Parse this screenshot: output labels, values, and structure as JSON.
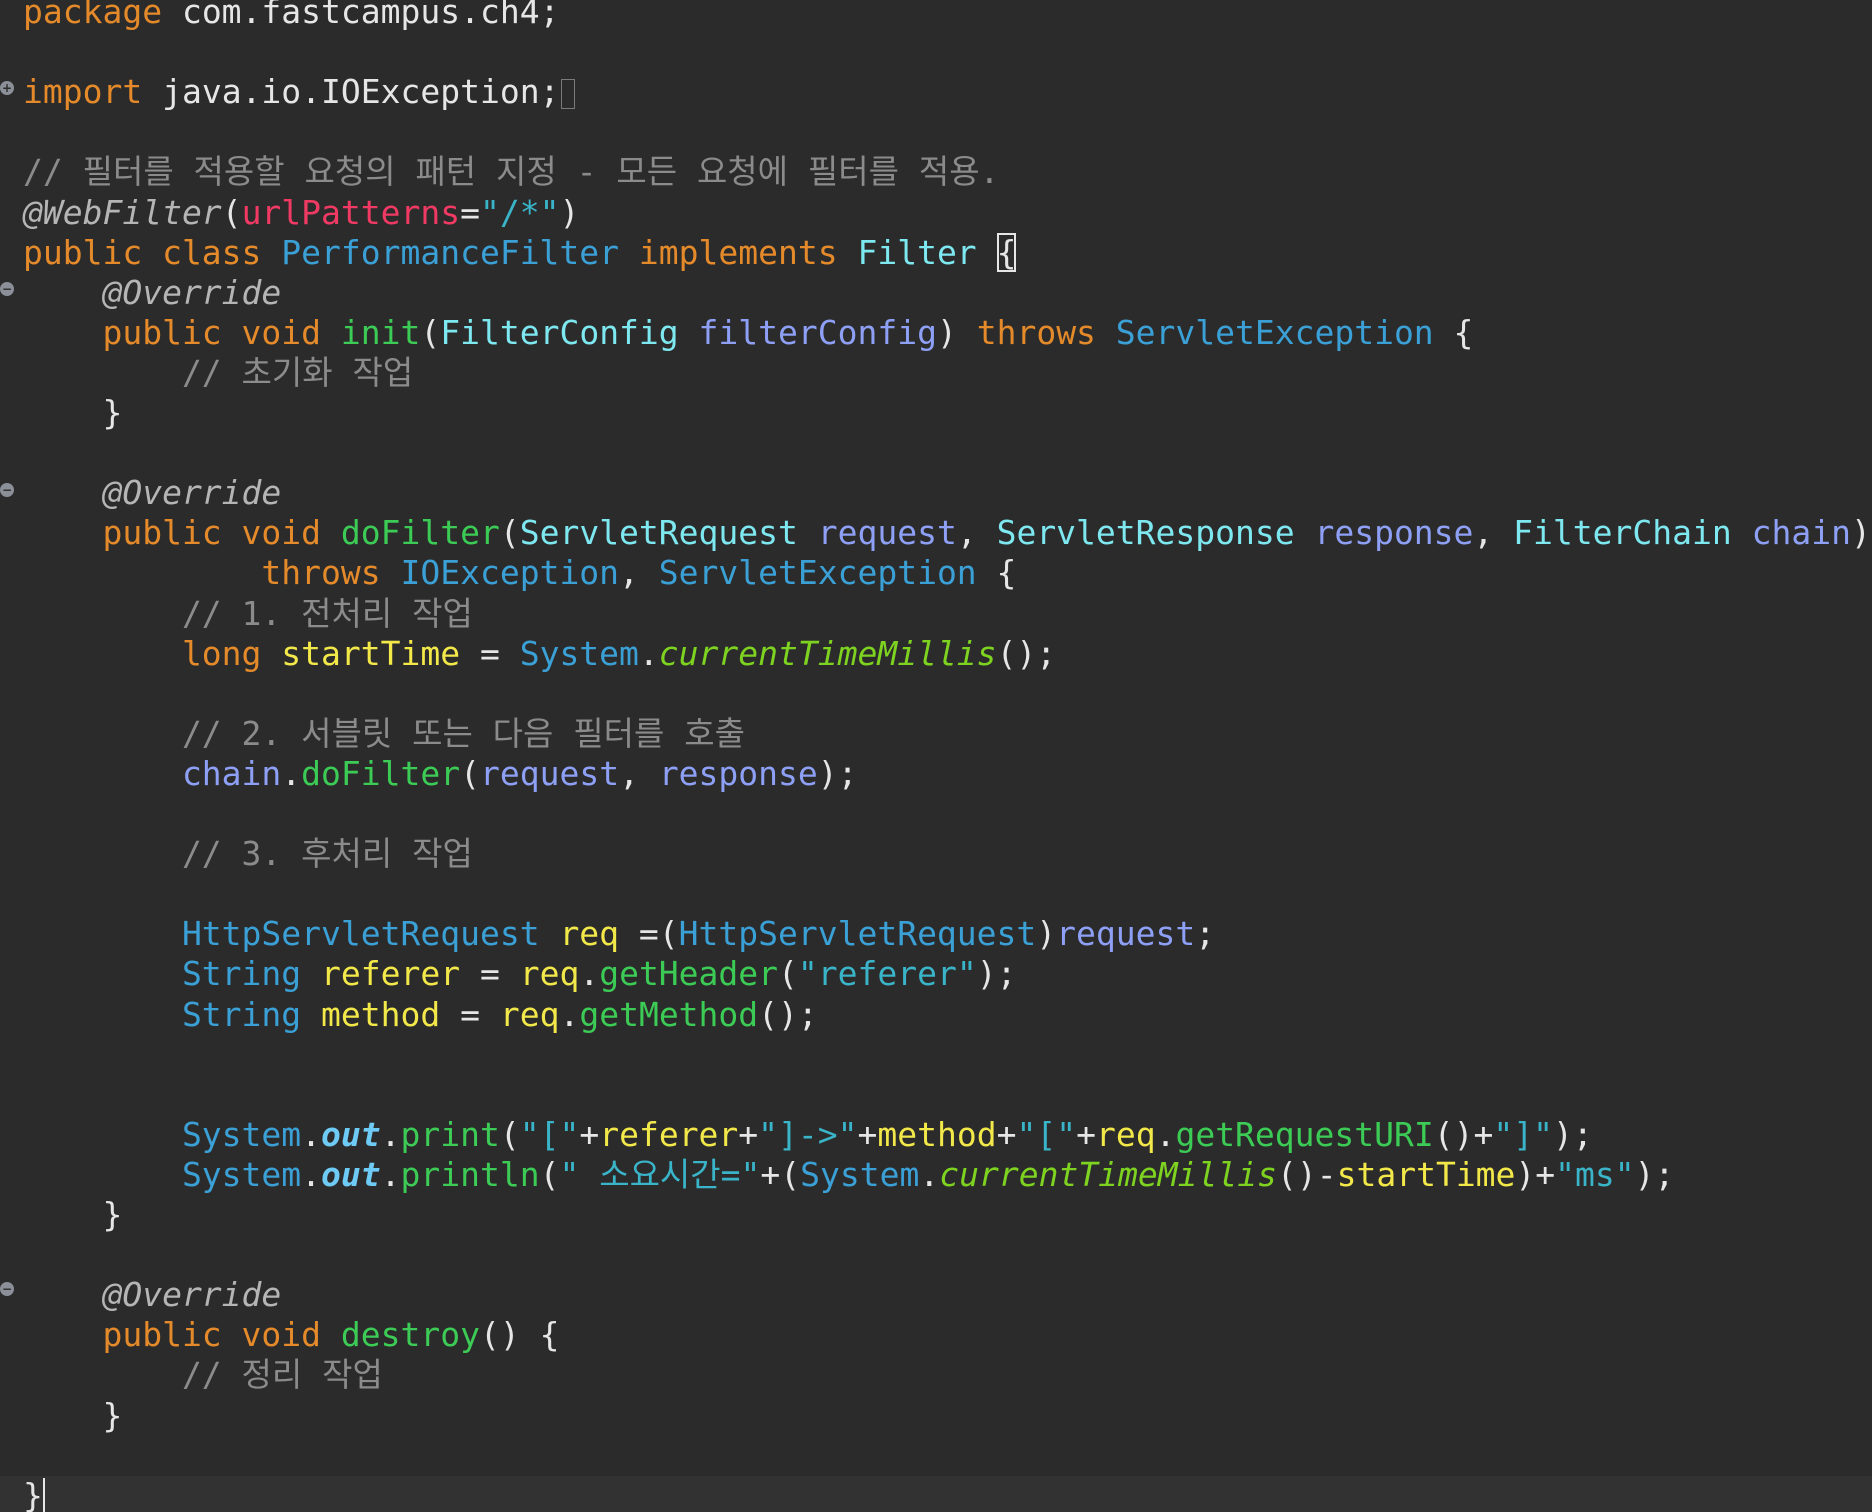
{
  "editor": {
    "gutter_markers": [
      {
        "kind": "expand",
        "glyph": "+"
      },
      {
        "kind": "collapse",
        "glyph": "−"
      },
      {
        "kind": "collapse",
        "glyph": "−"
      },
      {
        "kind": "collapse",
        "glyph": "−"
      }
    ],
    "lines": [
      [
        {
          "c": "kw",
          "t": "package"
        },
        {
          "c": "plain",
          "t": " com.fastcampus.ch4;"
        }
      ],
      [],
      [
        {
          "c": "kw",
          "t": "import"
        },
        {
          "c": "plain",
          "t": " java.io.IOException;"
        }
      ],
      [],
      [
        {
          "c": "cmt",
          "t": "// 필터를 적용할 요청의 패턴 지정 - 모든 요청에 필터를 적용."
        }
      ],
      [
        {
          "c": "ann",
          "t": "@WebFilter"
        },
        {
          "c": "plain",
          "t": "("
        },
        {
          "c": "attr",
          "t": "urlPatterns"
        },
        {
          "c": "plain",
          "t": "="
        },
        {
          "c": "str",
          "t": "\"/*\""
        },
        {
          "c": "plain",
          "t": ")"
        }
      ],
      [
        {
          "c": "kw",
          "t": "public class "
        },
        {
          "c": "cls",
          "t": "PerformanceFilter"
        },
        {
          "c": "kw",
          "t": " implements "
        },
        {
          "c": "iface",
          "t": "Filter"
        },
        {
          "c": "plain",
          "t": " "
        },
        {
          "c": "plain",
          "t": "{"
        }
      ],
      [
        {
          "c": "ann",
          "t": "    @Override"
        }
      ],
      [
        {
          "c": "kw",
          "t": "    public void "
        },
        {
          "c": "method",
          "t": "init"
        },
        {
          "c": "plain",
          "t": "("
        },
        {
          "c": "iface",
          "t": "FilterConfig"
        },
        {
          "c": "plain",
          "t": " "
        },
        {
          "c": "param",
          "t": "filterConfig"
        },
        {
          "c": "plain",
          "t": ") "
        },
        {
          "c": "kw",
          "t": "throws "
        },
        {
          "c": "ty",
          "t": "ServletException"
        },
        {
          "c": "plain",
          "t": " {"
        }
      ],
      [
        {
          "c": "cmt",
          "t": "        // 초기화 작업"
        }
      ],
      [
        {
          "c": "plain",
          "t": "    }"
        }
      ],
      [],
      [
        {
          "c": "ann",
          "t": "    @Override"
        }
      ],
      [
        {
          "c": "kw",
          "t": "    public void "
        },
        {
          "c": "method",
          "t": "doFilter"
        },
        {
          "c": "plain",
          "t": "("
        },
        {
          "c": "iface",
          "t": "ServletRequest"
        },
        {
          "c": "plain",
          "t": " "
        },
        {
          "c": "param",
          "t": "request"
        },
        {
          "c": "plain",
          "t": ", "
        },
        {
          "c": "iface",
          "t": "ServletResponse"
        },
        {
          "c": "plain",
          "t": " "
        },
        {
          "c": "param",
          "t": "response"
        },
        {
          "c": "plain",
          "t": ", "
        },
        {
          "c": "iface",
          "t": "FilterChain"
        },
        {
          "c": "plain",
          "t": " "
        },
        {
          "c": "param",
          "t": "chain"
        },
        {
          "c": "plain",
          "t": ")"
        }
      ],
      [
        {
          "c": "kw",
          "t": "            throws "
        },
        {
          "c": "ty",
          "t": "IOException"
        },
        {
          "c": "plain",
          "t": ", "
        },
        {
          "c": "ty",
          "t": "ServletException"
        },
        {
          "c": "plain",
          "t": " {"
        }
      ],
      [
        {
          "c": "cmt",
          "t": "        // 1. 전처리 작업"
        }
      ],
      [
        {
          "c": "kw",
          "t": "        long "
        },
        {
          "c": "local",
          "t": "startTime"
        },
        {
          "c": "plain",
          "t": " = "
        },
        {
          "c": "ty",
          "t": "System"
        },
        {
          "c": "plain",
          "t": "."
        },
        {
          "c": "methodi",
          "t": "currentTimeMillis"
        },
        {
          "c": "plain",
          "t": "();"
        }
      ],
      [],
      [
        {
          "c": "cmt",
          "t": "        // 2. 서블릿 또는 다음 필터를 호출"
        }
      ],
      [
        {
          "c": "param",
          "t": "        chain"
        },
        {
          "c": "plain",
          "t": "."
        },
        {
          "c": "method",
          "t": "doFilter"
        },
        {
          "c": "plain",
          "t": "("
        },
        {
          "c": "param",
          "t": "request"
        },
        {
          "c": "plain",
          "t": ", "
        },
        {
          "c": "param",
          "t": "response"
        },
        {
          "c": "plain",
          "t": ");"
        }
      ],
      [],
      [
        {
          "c": "cmt",
          "t": "        // 3. 후처리 작업"
        }
      ],
      [],
      [
        {
          "c": "ty",
          "t": "        HttpServletRequest"
        },
        {
          "c": "plain",
          "t": " "
        },
        {
          "c": "local",
          "t": "req"
        },
        {
          "c": "plain",
          "t": " =("
        },
        {
          "c": "ty",
          "t": "HttpServletRequest"
        },
        {
          "c": "plain",
          "t": ")"
        },
        {
          "c": "param",
          "t": "request"
        },
        {
          "c": "plain",
          "t": ";"
        }
      ],
      [
        {
          "c": "ty",
          "t": "        String"
        },
        {
          "c": "plain",
          "t": " "
        },
        {
          "c": "local",
          "t": "referer"
        },
        {
          "c": "plain",
          "t": " = "
        },
        {
          "c": "local",
          "t": "req"
        },
        {
          "c": "plain",
          "t": "."
        },
        {
          "c": "method",
          "t": "getHeader"
        },
        {
          "c": "plain",
          "t": "("
        },
        {
          "c": "str",
          "t": "\"referer\""
        },
        {
          "c": "plain",
          "t": ");"
        }
      ],
      [
        {
          "c": "ty",
          "t": "        String"
        },
        {
          "c": "plain",
          "t": " "
        },
        {
          "c": "local",
          "t": "method"
        },
        {
          "c": "plain",
          "t": " = "
        },
        {
          "c": "local",
          "t": "req"
        },
        {
          "c": "plain",
          "t": "."
        },
        {
          "c": "method",
          "t": "getMethod"
        },
        {
          "c": "plain",
          "t": "();"
        }
      ],
      [],
      [],
      [
        {
          "c": "ty",
          "t": "        System"
        },
        {
          "c": "plain",
          "t": "."
        },
        {
          "c": "field",
          "t": "out"
        },
        {
          "c": "plain",
          "t": "."
        },
        {
          "c": "method",
          "t": "print"
        },
        {
          "c": "plain",
          "t": "("
        },
        {
          "c": "str",
          "t": "\"[\""
        },
        {
          "c": "plain",
          "t": "+"
        },
        {
          "c": "local",
          "t": "referer"
        },
        {
          "c": "plain",
          "t": "+"
        },
        {
          "c": "str",
          "t": "\"]->\""
        },
        {
          "c": "plain",
          "t": "+"
        },
        {
          "c": "local",
          "t": "method"
        },
        {
          "c": "plain",
          "t": "+"
        },
        {
          "c": "str",
          "t": "\"[\""
        },
        {
          "c": "plain",
          "t": "+"
        },
        {
          "c": "local",
          "t": "req"
        },
        {
          "c": "plain",
          "t": "."
        },
        {
          "c": "method",
          "t": "getRequestURI"
        },
        {
          "c": "plain",
          "t": "()+"
        },
        {
          "c": "str",
          "t": "\"]\""
        },
        {
          "c": "plain",
          "t": ");"
        }
      ],
      [
        {
          "c": "ty",
          "t": "        System"
        },
        {
          "c": "plain",
          "t": "."
        },
        {
          "c": "field",
          "t": "out"
        },
        {
          "c": "plain",
          "t": "."
        },
        {
          "c": "method",
          "t": "println"
        },
        {
          "c": "plain",
          "t": "("
        },
        {
          "c": "str",
          "t": "\" 소요시간=\""
        },
        {
          "c": "plain",
          "t": "+("
        },
        {
          "c": "ty",
          "t": "System"
        },
        {
          "c": "plain",
          "t": "."
        },
        {
          "c": "methodi",
          "t": "currentTimeMillis"
        },
        {
          "c": "plain",
          "t": "()-"
        },
        {
          "c": "local",
          "t": "startTime"
        },
        {
          "c": "plain",
          "t": ")+"
        },
        {
          "c": "str",
          "t": "\"ms\""
        },
        {
          "c": "plain",
          "t": ");"
        }
      ],
      [
        {
          "c": "plain",
          "t": "    }"
        }
      ],
      [],
      [
        {
          "c": "ann",
          "t": "    @Override"
        }
      ],
      [
        {
          "c": "kw",
          "t": "    public void "
        },
        {
          "c": "method",
          "t": "destroy"
        },
        {
          "c": "plain",
          "t": "() {"
        }
      ],
      [
        {
          "c": "cmt",
          "t": "        // 정리 작업"
        }
      ],
      [
        {
          "c": "plain",
          "t": "    }"
        }
      ],
      [],
      [
        {
          "c": "plain",
          "t": "}"
        }
      ]
    ]
  }
}
